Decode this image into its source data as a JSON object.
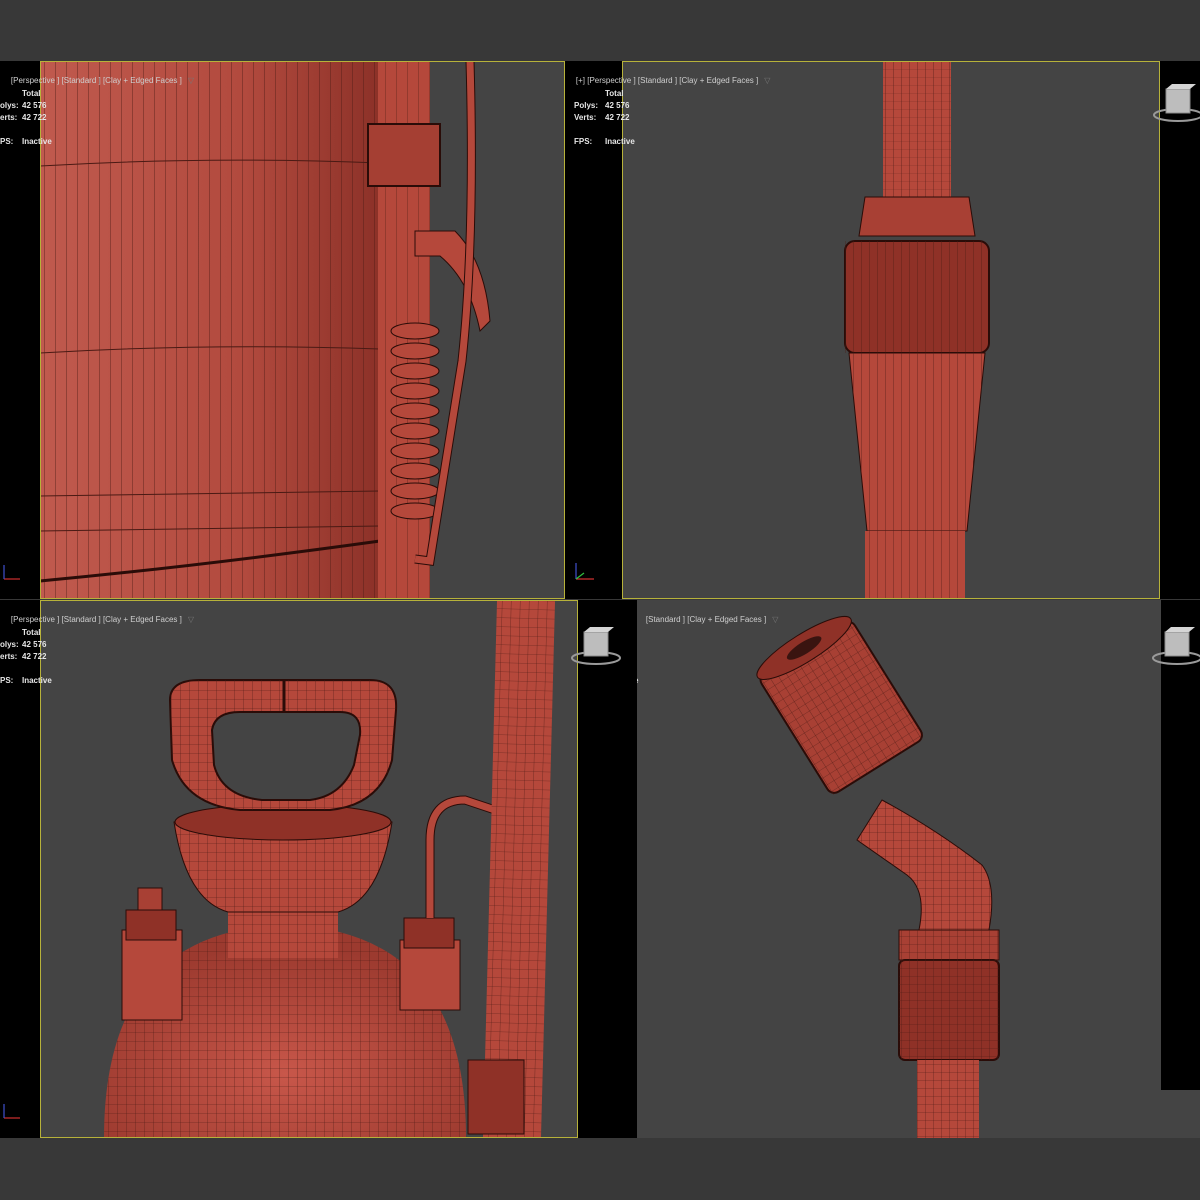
{
  "viewports": [
    {
      "label_left": "[Perspective ] [Standard ] [Clay + Edged Faces ]",
      "filter_icon": "funnel-icon",
      "stats": {
        "total_label": "Total",
        "polys_label": "olys:",
        "polys_value": "42 576",
        "verts_label": "erts:",
        "verts_value": "42 722",
        "fps_label": "PS:",
        "fps_value": "Inactive"
      },
      "subject": "tank-and-pump-handle-closeup"
    },
    {
      "label_left": "[+] [Perspective ] [Standard ] [Clay + Edged Faces ]",
      "filter_icon": "funnel-icon",
      "stats": {
        "total_label": "Total",
        "polys_label": "Polys:",
        "polys_value": "42 576",
        "verts_label": "Verts:",
        "verts_value": "42 722",
        "fps_label": "FPS:",
        "fps_value": "Inactive"
      },
      "subject": "wand-coupling-closeup"
    },
    {
      "label_left": "[Perspective ] [Standard ] [Clay + Edged Faces ]",
      "filter_icon": "funnel-icon",
      "stats": {
        "total_label": "Total",
        "polys_label": "olys:",
        "polys_value": "42 576",
        "verts_label": "erts:",
        "verts_value": "42 722",
        "fps_label": "PS:",
        "fps_value": "Inactive"
      },
      "subject": "sprayer-top-handle"
    },
    {
      "label_left": "[Standard ] [Clay + Edged Faces ]",
      "filter_icon": "funnel-icon",
      "stats_fragment": "e",
      "subject": "nozzle-closeup"
    }
  ],
  "colors": {
    "background": "#383838",
    "viewport_bg": "#444444",
    "active_border": "#b7b23a",
    "clay": "#b3473a",
    "wire": "#3a1410"
  }
}
